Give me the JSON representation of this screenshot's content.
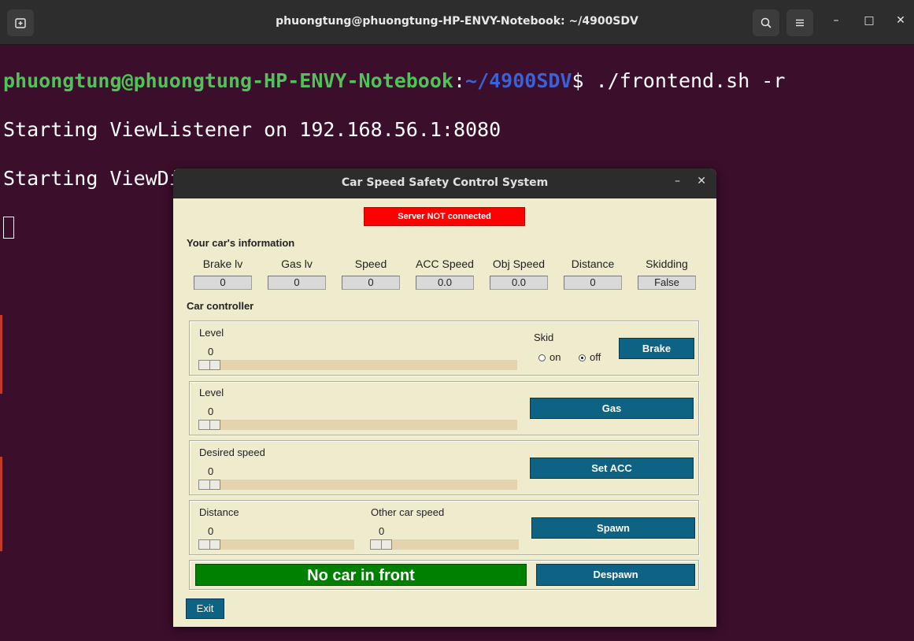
{
  "terminal": {
    "title": "phuongtung@phuongtung-HP-ENVY-Notebook: ~/4900SDV",
    "prompt_user": "phuongtung@phuongtung-HP-ENVY-Notebook",
    "prompt_colon": ":",
    "prompt_path": "~/4900SDV",
    "prompt_cmd": "$ ./frontend.sh -r",
    "line1": "Starting ViewListener on 192.168.56.1:8080",
    "line2": "Starting ViewDispatcher on 192.168.56.101:8080",
    "icons": {
      "new_tab": "new-tab-icon",
      "search": "search-icon",
      "menu": "hamburger-menu-icon"
    },
    "window_controls": {
      "minimize": "–",
      "maximize": "□",
      "close": "✕"
    }
  },
  "app": {
    "title": "Car Speed Safety Control System",
    "controls": {
      "minimize": "–",
      "close": "✕"
    },
    "status": "Server NOT connected",
    "info_heading": "Your car's information",
    "info": [
      {
        "label": "Brake lv",
        "value": "0"
      },
      {
        "label": "Gas lv",
        "value": "0"
      },
      {
        "label": "Speed",
        "value": "0"
      },
      {
        "label": "ACC Speed",
        "value": "0.0"
      },
      {
        "label": "Obj Speed",
        "value": "0.0"
      },
      {
        "label": "Distance",
        "value": "0"
      },
      {
        "label": "Skidding",
        "value": "False"
      }
    ],
    "controller_heading": "Car controller",
    "brake": {
      "label": "Level",
      "value": "0",
      "skid_label": "Skid",
      "skid_on": "on",
      "skid_off": "off",
      "skid_selected": "off",
      "button": "Brake"
    },
    "gas": {
      "label": "Level",
      "value": "0",
      "button": "Gas"
    },
    "acc": {
      "label": "Desired speed",
      "value": "0",
      "button": "Set ACC"
    },
    "spawn": {
      "distance_label": "Distance",
      "distance_value": "0",
      "other_label": "Other car speed",
      "other_value": "0",
      "button": "Spawn"
    },
    "front_status": "No car in front",
    "despawn_button": "Despawn",
    "exit_button": "Exit"
  },
  "colors": {
    "terminal_bg": "#3b0e2b",
    "prompt_user": "#4fc25a",
    "prompt_path": "#3a62d8",
    "app_bg": "#efebcd",
    "button": "#0e6283",
    "status_error": "#ff0000",
    "front_ok": "#008000",
    "trough": "#e5d3ad"
  }
}
